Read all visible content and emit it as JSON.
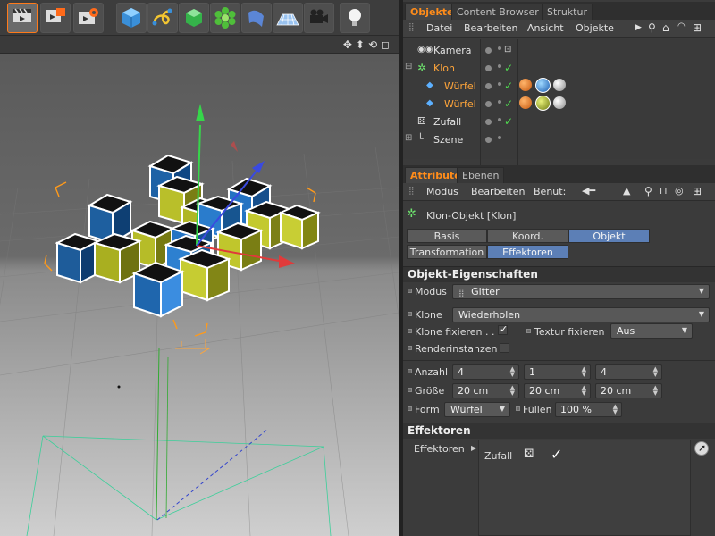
{
  "manager_tabs": [
    "Objekte",
    "Content Browser",
    "Struktur"
  ],
  "object_menu": [
    "Datei",
    "Bearbeiten",
    "Ansicht",
    "Objekte"
  ],
  "objects": [
    {
      "name": "Kamera",
      "color": "white"
    },
    {
      "name": "Klon",
      "color": "orange"
    },
    {
      "name": "Würfel",
      "color": "orange"
    },
    {
      "name": "Würfel",
      "color": "orange"
    },
    {
      "name": "Zufall",
      "color": "white"
    },
    {
      "name": "Szene",
      "color": "white"
    }
  ],
  "attr_tabs": [
    "Attribute",
    "Ebenen"
  ],
  "attr_menu": [
    "Modus",
    "Bearbeiten",
    "Benut:"
  ],
  "object_title": "Klon-Objekt [Klon]",
  "mode_tabs": {
    "basis": "Basis",
    "koord": "Koord.",
    "objekt": "Objekt",
    "transformation": "Transformation",
    "effektoren": "Effektoren"
  },
  "props": {
    "section": "Objekt-Eigenschaften",
    "modus_label": "Modus",
    "modus_value": "Gitter",
    "klone_label": "Klone",
    "klone_value": "Wiederholen",
    "klone_fix_label": "Klone fixieren . .",
    "klone_fix_checked": true,
    "textur_label": "Textur fixieren",
    "textur_value": "Aus",
    "render_label": "Renderinstanzen",
    "render_checked": false,
    "anzahl_label": "Anzahl",
    "anzahl": [
      "4",
      "1",
      "4"
    ],
    "groesse_label": "Größe",
    "groesse": [
      "20 cm",
      "20 cm",
      "20 cm"
    ],
    "form_label": "Form",
    "form_value": "Würfel",
    "fuellen_label": "Füllen",
    "fuellen_value": "100 %"
  },
  "effectors": {
    "section": "Effektoren",
    "label": "Effektoren",
    "items": [
      {
        "name": "Zufall",
        "enabled": true
      }
    ]
  },
  "colors": {
    "accent_orange": "#ff8c1a",
    "active_tab_blue": "#5c7fb6",
    "enabled_green": "#4fd84f"
  }
}
